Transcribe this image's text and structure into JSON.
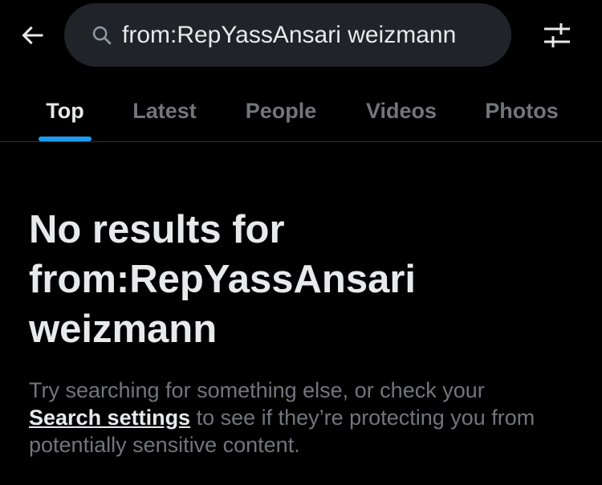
{
  "header": {
    "back_icon": "arrow-left-icon",
    "search": {
      "icon": "search-icon",
      "value": "from:RepYassAnsari weizmann"
    },
    "filter_icon": "filter-sliders-icon"
  },
  "tabs": [
    {
      "label": "Top",
      "active": true
    },
    {
      "label": "Latest",
      "active": false
    },
    {
      "label": "People",
      "active": false
    },
    {
      "label": "Videos",
      "active": false
    },
    {
      "label": "Photos",
      "active": false
    }
  ],
  "empty_state": {
    "title_line1": "No results for",
    "title_line2": "from:RepYassAnsari",
    "title_line3": "weizmann",
    "body_prefix": "Try searching for something else, or check your",
    "link_label": "Search settings",
    "body_suffix": " to see if they’re protecting you from potentially sensitive content."
  },
  "colors": {
    "background": "#000000",
    "search_bg": "#202327",
    "primary_text": "#e7e9ea",
    "secondary_text": "#71767b",
    "accent": "#1d9bf0",
    "divider": "#2f3336"
  }
}
